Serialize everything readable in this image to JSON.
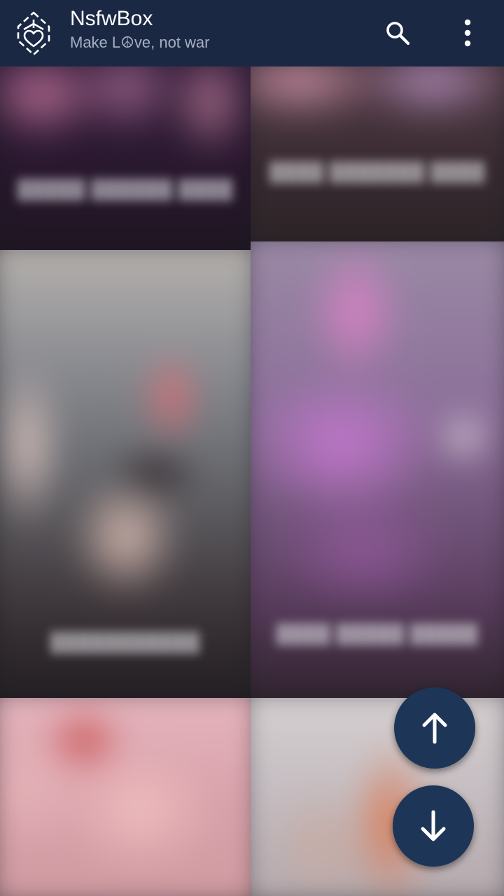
{
  "appbar": {
    "title": "NsfwBox",
    "subtitle": "Make L☮ve, not war",
    "logo_icon": "heart-diamond-logo-icon",
    "search_icon": "search-icon",
    "more_icon": "more-vert-icon"
  },
  "colors": {
    "appbar_bg": "#1b2844",
    "fab_bg": "#1d3557",
    "fab_icon": "#ffffff"
  },
  "fab": {
    "up_icon": "arrow-up-icon",
    "down_icon": "arrow-down-icon"
  },
  "grid": {
    "tiles": [
      {
        "caption": "█████ ██████ ████"
      },
      {
        "caption": "████ ███████ ████"
      },
      {
        "caption": "███████████"
      },
      {
        "caption": "████ █████ █████"
      },
      {
        "caption": ""
      },
      {
        "caption": ""
      }
    ]
  }
}
